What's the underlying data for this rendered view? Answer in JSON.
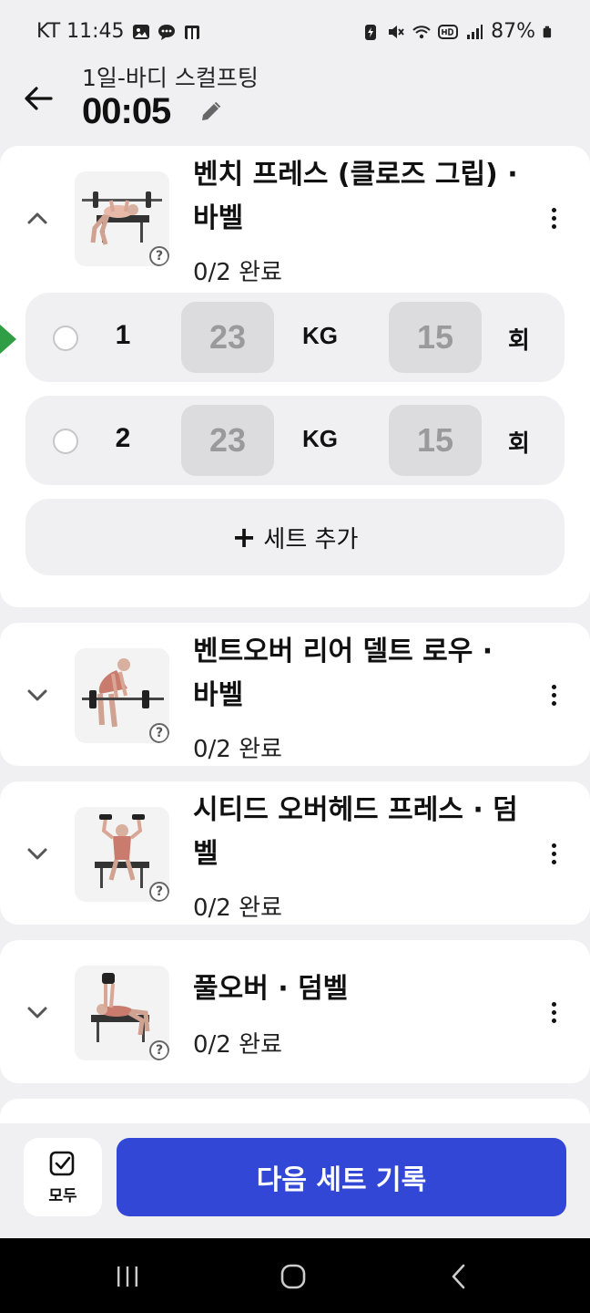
{
  "status_bar": {
    "carrier_time": "KT 11:45",
    "battery": "87%"
  },
  "header": {
    "routine_name": "1일-바디 스컬프팅",
    "timer": "00:05"
  },
  "exercises": [
    {
      "title": "벤치 프레스 (클로즈 그립) · 바벨",
      "progress": "0/2 완료",
      "expanded": true,
      "sets": [
        {
          "number": "1",
          "weight": "23",
          "weight_unit": "KG",
          "reps": "15",
          "reps_unit": "회"
        },
        {
          "number": "2",
          "weight": "23",
          "weight_unit": "KG",
          "reps": "15",
          "reps_unit": "회"
        }
      ],
      "add_set_label": "세트 추가"
    },
    {
      "title": "벤트오버 리어 델트 로우 · 바벨",
      "progress": "0/2 완료",
      "expanded": false
    },
    {
      "title": "시티드 오버헤드 프레스 · 덤벨",
      "progress": "0/2 완료",
      "expanded": false
    },
    {
      "title": "풀오버 · 덤벨",
      "progress": "0/2 완료",
      "expanded": false
    }
  ],
  "bottom": {
    "all_label": "모두",
    "primary_label": "다음 세트 기록",
    "primary_color": "#3347d6"
  },
  "icons": {
    "back": "arrow-left-icon",
    "edit": "pencil-icon",
    "expand": "chevron-down-icon",
    "collapse": "chevron-up-icon",
    "more": "kebab-icon",
    "help": "question-icon",
    "check": "checkbox-icon"
  },
  "help_glyph": "?"
}
